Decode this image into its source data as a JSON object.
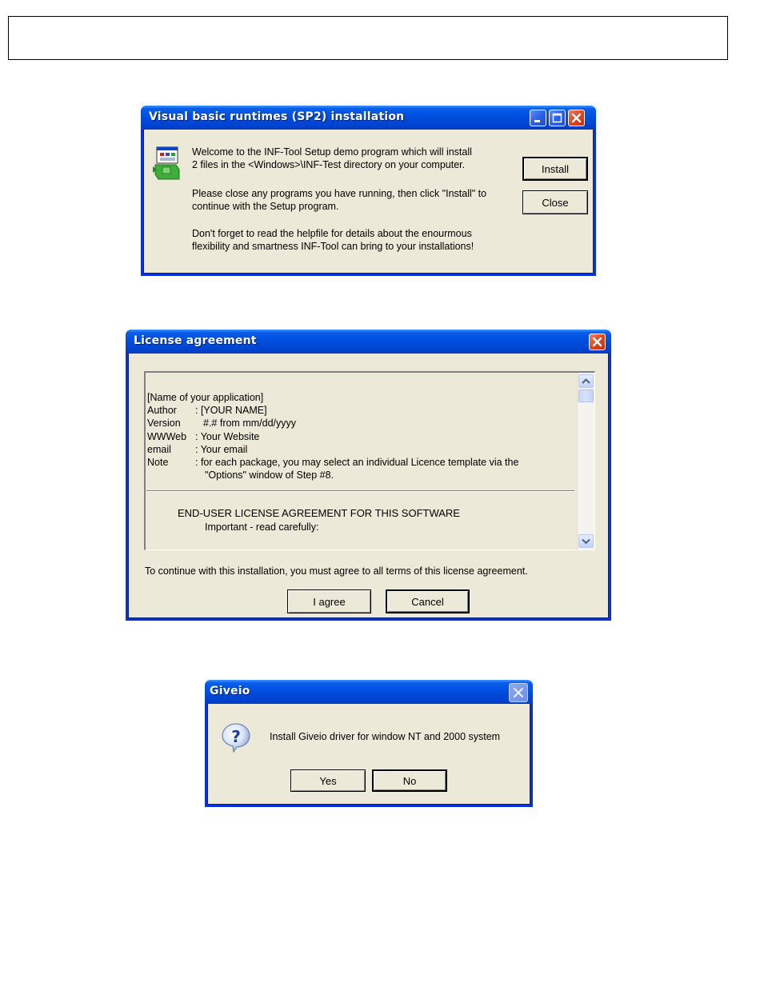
{
  "installer": {
    "title": "Visual basic runtimes (SP2) installation",
    "paragraphs": [
      [
        "Welcome to the INF-Tool Setup demo program which will install",
        "2 files in the <Windows>\\INF-Test directory on your computer."
      ],
      [
        "Please close any programs you have running, then click \"Install\" to",
        "continue with the Setup program."
      ],
      [
        "Don't forget to read the helpfile for details about the enourmous",
        "flexibility and smartness INF-Tool can bring to your installations!"
      ]
    ],
    "install_label": "Install",
    "close_label": "Close",
    "icon": "setup-program-icon",
    "controls": [
      "minimize-icon",
      "maximize-icon",
      "close-icon"
    ]
  },
  "license": {
    "title": "License agreement",
    "header_line": "[Name of your application]",
    "fields": [
      {
        "key": "Author",
        "value": ": [YOUR NAME]"
      },
      {
        "key": "Version",
        "value": "#.# from mm/dd/yyyy"
      },
      {
        "key": "WWWeb",
        "value": ": Your Website"
      },
      {
        "key": "email",
        "value": ": Your email"
      },
      {
        "key": "Note",
        "value": ": for each package, you may select an individual Licence template via the"
      }
    ],
    "note_continuation": "\"Options\" window of Step #8.",
    "eula_heading": "END-USER LICENSE AGREEMENT FOR THIS SOFTWARE",
    "eula_sub": "Important - read carefully:",
    "agreement_text": "To continue with this installation, you must agree to all terms of this license agreement.",
    "agree_label": "I agree",
    "cancel_label": "Cancel"
  },
  "giveio": {
    "title": "Giveio",
    "message": "Install Giveio driver for window NT and 2000 system",
    "yes_label": "Yes",
    "no_label": "No",
    "icon": "question-icon"
  },
  "colors": {
    "titlebar": "#0055E5",
    "dialog_bg": "#ECE9D8",
    "close_button": "#E0451F"
  }
}
